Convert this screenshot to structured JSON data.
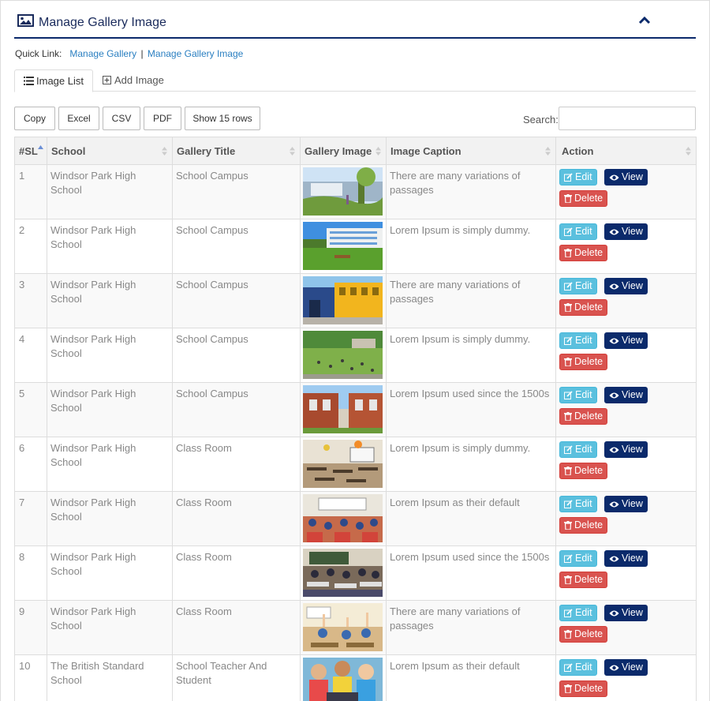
{
  "header": {
    "title": "Manage Gallery Image"
  },
  "quicklink": {
    "label": "Quick Link:",
    "link1": "Manage Gallery",
    "separator": "|",
    "link2": "Manage Gallery Image"
  },
  "tabs": {
    "image_list": "Image List",
    "add_image": "Add Image"
  },
  "buttons": {
    "copy": "Copy",
    "excel": "Excel",
    "csv": "CSV",
    "pdf": "PDF",
    "show_rows": "Show 15 rows"
  },
  "search": {
    "label": "Search:",
    "value": ""
  },
  "table": {
    "headers": {
      "sl": "#SL",
      "school": "School",
      "gallery_title": "Gallery Title",
      "gallery_image": "Gallery Image",
      "caption": "Image Caption",
      "action": "Action"
    },
    "actions": {
      "edit": "Edit",
      "view": "View",
      "delete": "Delete"
    },
    "rows": [
      {
        "sl": "1",
        "school": "Windsor Park High School",
        "title": "School Campus",
        "caption": "There are many variations of passages",
        "image": "campus-garden"
      },
      {
        "sl": "2",
        "school": "Windsor Park High School",
        "title": "School Campus",
        "caption": "Lorem Ipsum is simply dummy.",
        "image": "campus-building-lawn"
      },
      {
        "sl": "3",
        "school": "Windsor Park High School",
        "title": "School Campus",
        "caption": "There are many variations of passages",
        "image": "campus-yellow-building"
      },
      {
        "sl": "4",
        "school": "Windsor Park High School",
        "title": "School Campus",
        "caption": "Lorem Ipsum is simply dummy.",
        "image": "campus-students-lawn"
      },
      {
        "sl": "5",
        "school": "Windsor Park High School",
        "title": "School Campus",
        "caption": "Lorem Ipsum used since the 1500s",
        "image": "campus-brick-building"
      },
      {
        "sl": "6",
        "school": "Windsor Park High School",
        "title": "Class Room",
        "caption": "Lorem Ipsum is simply dummy.",
        "image": "classroom-empty"
      },
      {
        "sl": "7",
        "school": "Windsor Park High School",
        "title": "Class Room",
        "caption": "Lorem Ipsum as their default",
        "image": "classroom-students"
      },
      {
        "sl": "8",
        "school": "Windsor Park High School",
        "title": "Class Room",
        "caption": "Lorem Ipsum used since the 1500s",
        "image": "classroom-desks"
      },
      {
        "sl": "9",
        "school": "Windsor Park High School",
        "title": "Class Room",
        "caption": "There are many variations of passages",
        "image": "classroom-hands-up"
      },
      {
        "sl": "10",
        "school": "The British Standard School",
        "title": "School Teacher And Student",
        "caption": "Lorem Ipsum as their default",
        "image": "teacher-students"
      }
    ]
  },
  "colors": {
    "navy": "#0b2a6b",
    "edit": "#5bc0de",
    "delete": "#d9534f",
    "link": "#2a7fc1"
  }
}
